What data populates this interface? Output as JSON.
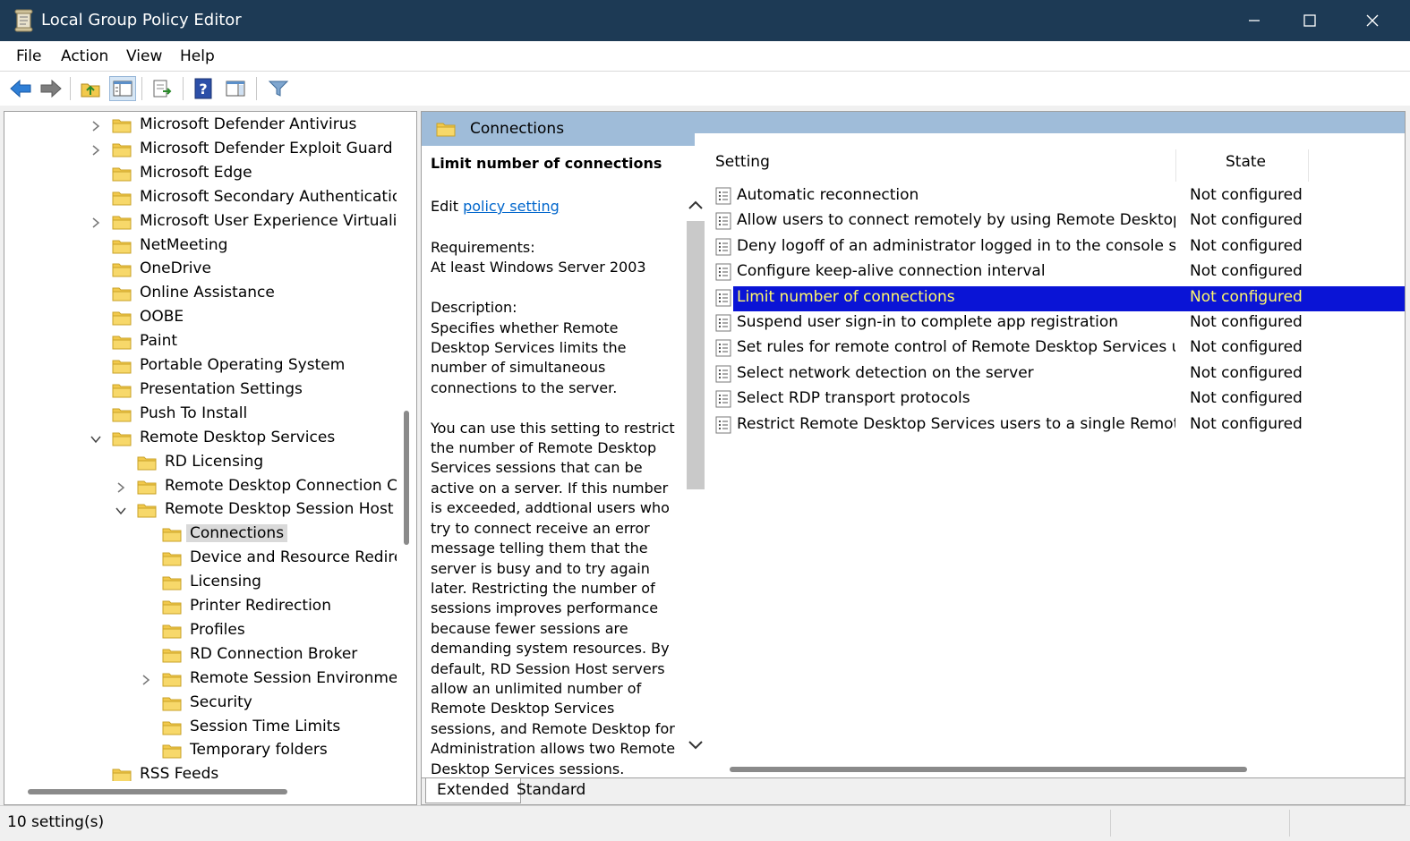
{
  "window": {
    "title": "Local Group Policy Editor",
    "icons": {
      "app": "policy-scroll-icon",
      "minimize": "minimize-icon",
      "maximize": "maximize-icon",
      "close": "close-icon"
    }
  },
  "menu": {
    "items": [
      "File",
      "Action",
      "View",
      "Help"
    ]
  },
  "toolbar": {
    "buttons": [
      {
        "icon": "back-arrow-icon"
      },
      {
        "icon": "forward-arrow-icon"
      },
      {
        "icon": "up-folder-icon"
      },
      {
        "icon": "show-hide-console-tree-icon",
        "pressed": true
      },
      {
        "icon": "export-list-icon"
      },
      {
        "icon": "help-icon"
      },
      {
        "icon": "show-hide-action-pane-icon"
      },
      {
        "icon": "filter-icon"
      }
    ]
  },
  "tree": {
    "items": [
      {
        "label": "Microsoft Defender Antivirus",
        "level": 0,
        "expander": "collapsed"
      },
      {
        "label": "Microsoft Defender Exploit Guard",
        "level": 0,
        "expander": "collapsed"
      },
      {
        "label": "Microsoft Edge",
        "level": 0,
        "expander": "none"
      },
      {
        "label": "Microsoft Secondary Authentication",
        "level": 0,
        "expander": "none"
      },
      {
        "label": "Microsoft User Experience Virtualizat",
        "level": 0,
        "expander": "collapsed"
      },
      {
        "label": "NetMeeting",
        "level": 0,
        "expander": "none"
      },
      {
        "label": "OneDrive",
        "level": 0,
        "expander": "none"
      },
      {
        "label": "Online Assistance",
        "level": 0,
        "expander": "none"
      },
      {
        "label": "OOBE",
        "level": 0,
        "expander": "none"
      },
      {
        "label": "Paint",
        "level": 0,
        "expander": "none"
      },
      {
        "label": "Portable Operating System",
        "level": 0,
        "expander": "none"
      },
      {
        "label": "Presentation Settings",
        "level": 0,
        "expander": "none"
      },
      {
        "label": "Push To Install",
        "level": 0,
        "expander": "none"
      },
      {
        "label": "Remote Desktop Services",
        "level": 0,
        "expander": "expanded"
      },
      {
        "label": "RD Licensing",
        "level": 1,
        "expander": "none"
      },
      {
        "label": "Remote Desktop Connection Clie",
        "level": 1,
        "expander": "collapsed"
      },
      {
        "label": "Remote Desktop Session Host",
        "level": 1,
        "expander": "expanded"
      },
      {
        "label": "Connections",
        "level": 2,
        "expander": "none",
        "selected": true
      },
      {
        "label": "Device and Resource Redirect",
        "level": 2,
        "expander": "none"
      },
      {
        "label": "Licensing",
        "level": 2,
        "expander": "none"
      },
      {
        "label": "Printer Redirection",
        "level": 2,
        "expander": "none"
      },
      {
        "label": "Profiles",
        "level": 2,
        "expander": "none"
      },
      {
        "label": "RD Connection Broker",
        "level": 2,
        "expander": "none"
      },
      {
        "label": "Remote Session Environment",
        "level": 2,
        "expander": "collapsed"
      },
      {
        "label": "Security",
        "level": 2,
        "expander": "none"
      },
      {
        "label": "Session Time Limits",
        "level": 2,
        "expander": "none"
      },
      {
        "label": "Temporary folders",
        "level": 2,
        "expander": "none"
      },
      {
        "label": "RSS Feeds",
        "level": 0,
        "expander": "none"
      }
    ]
  },
  "details": {
    "header": "Connections",
    "description": {
      "heading": "Limit number of connections",
      "edit_prefix": "Edit ",
      "edit_link": "policy setting ",
      "body": "Requirements:\nAt least Windows Server 2003\n\nDescription:\nSpecifies whether Remote Desktop Services limits the number of simultaneous connections to the server.\n\nYou can use this setting to restrict the number of Remote Desktop Services sessions that can be active on a server. If this number is exceeded, addtional users who try to connect receive an error message telling them that the server is busy and to try again later. Restricting the number of sessions improves performance because fewer sessions are demanding system resources. By default, RD Session Host servers allow an unlimited number of Remote Desktop Services sessions, and Remote Desktop for Administration allows two Remote Desktop Services sessions."
    },
    "columns": {
      "setting": "Setting",
      "state": "State"
    },
    "settings": [
      {
        "name": "Automatic reconnection",
        "state": "Not configured"
      },
      {
        "name": "Allow users to connect remotely by using Remote Desktop Se...",
        "state": "Not configured"
      },
      {
        "name": "Deny logoff of an administrator logged in to the console ses...",
        "state": "Not configured"
      },
      {
        "name": "Configure keep-alive connection interval",
        "state": "Not configured"
      },
      {
        "name": "Limit number of connections",
        "state": "Not configured",
        "selected": true
      },
      {
        "name": "Suspend user sign-in to complete app registration",
        "state": "Not configured"
      },
      {
        "name": "Set rules for remote control of Remote Desktop Services user ...",
        "state": "Not configured"
      },
      {
        "name": "Select network detection on the server",
        "state": "Not configured"
      },
      {
        "name": "Select RDP transport protocols",
        "state": "Not configured"
      },
      {
        "name": "Restrict Remote Desktop Services users to a single Remote De...",
        "state": "Not configured"
      }
    ],
    "tabs": [
      "Extended",
      "Standard"
    ],
    "active_tab": "Extended"
  },
  "status": {
    "text": "10 setting(s)"
  },
  "colors": {
    "titlebar": "#1d3a55",
    "header_band": "#9fbcd9",
    "selection": "#0a14d6",
    "selection_text": "#fff86b",
    "folder": "#f2c94c",
    "link": "#0066cc"
  }
}
